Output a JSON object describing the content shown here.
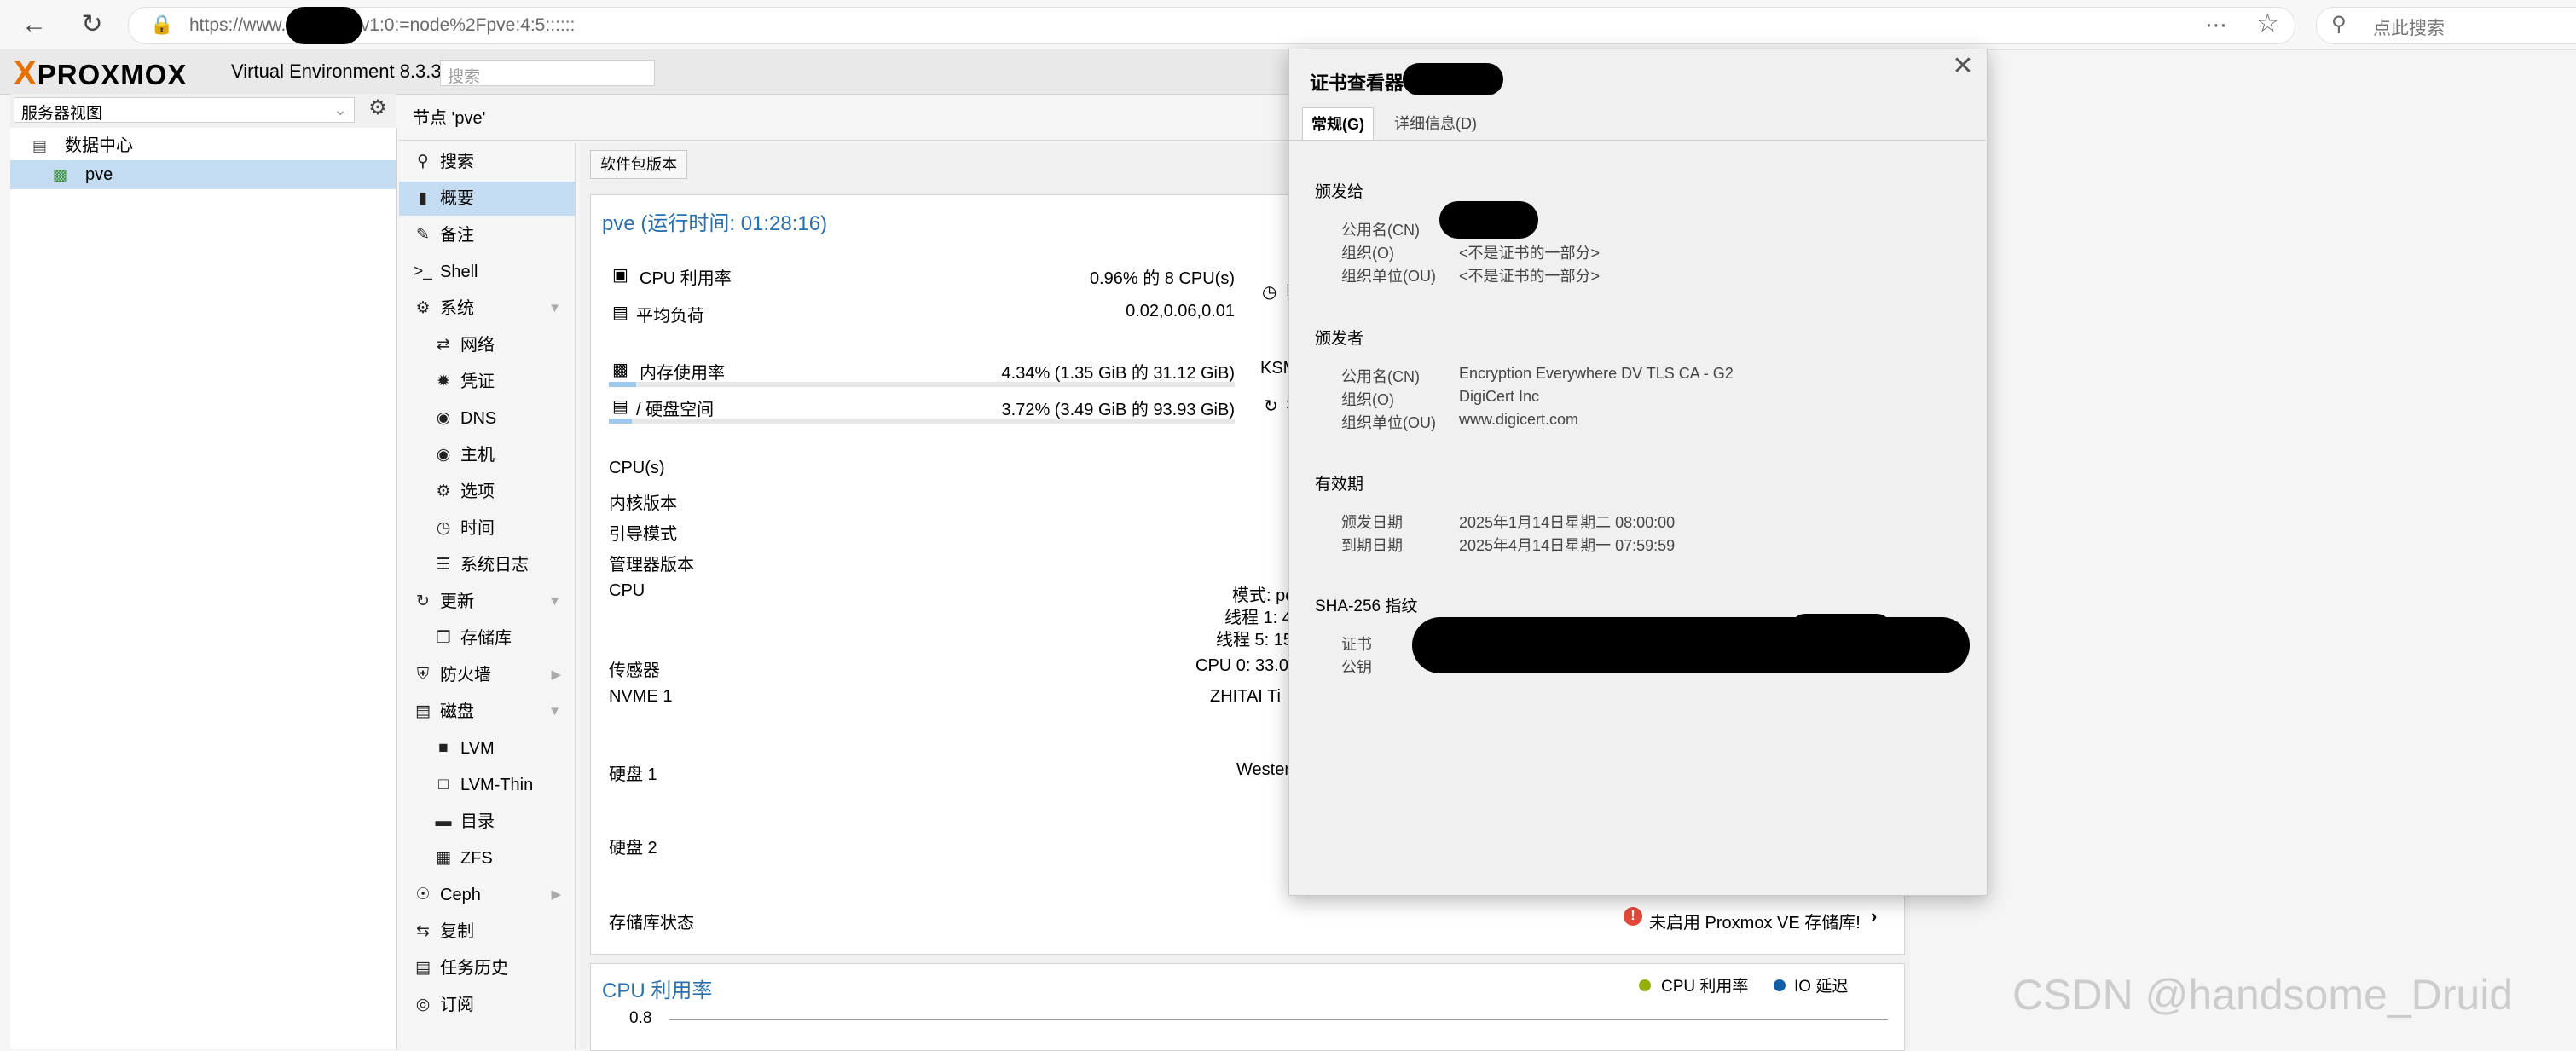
{
  "browser": {
    "url_text": "https://www.        n:8006/#v1:0:=node%2Fpve:4:5::::::",
    "search_placeholder": "点此搜索"
  },
  "header": {
    "logo_text": "PROXMOX",
    "version": "Virtual Environment 8.3.3",
    "search_placeholder": "搜索"
  },
  "tree": {
    "view_selector": "服务器视图",
    "items": [
      {
        "label": "数据中心"
      },
      {
        "label": "pve"
      }
    ]
  },
  "node_title": "节点 'pve'",
  "nav": {
    "items": [
      {
        "label": "搜索",
        "icon": "search-icon"
      },
      {
        "label": "概要",
        "icon": "book-icon"
      },
      {
        "label": "备注",
        "icon": "edit-icon"
      },
      {
        "label": "Shell",
        "icon": "terminal-icon"
      },
      {
        "label": "系统",
        "icon": "cogs-icon"
      },
      {
        "label": "网络",
        "icon": "network-icon"
      },
      {
        "label": "凭证",
        "icon": "certificate-icon"
      },
      {
        "label": "DNS",
        "icon": "globe-icon"
      },
      {
        "label": "主机",
        "icon": "globe-icon"
      },
      {
        "label": "选项",
        "icon": "gear-icon"
      },
      {
        "label": "时间",
        "icon": "clock-icon"
      },
      {
        "label": "系统日志",
        "icon": "list-icon"
      },
      {
        "label": "更新",
        "icon": "refresh-icon"
      },
      {
        "label": "存储库",
        "icon": "files-icon"
      },
      {
        "label": "防火墙",
        "icon": "shield-icon"
      },
      {
        "label": "磁盘",
        "icon": "hdd-icon"
      },
      {
        "label": "LVM",
        "icon": "square-icon"
      },
      {
        "label": "LVM-Thin",
        "icon": "square-outline-icon"
      },
      {
        "label": "目录",
        "icon": "folder-icon"
      },
      {
        "label": "ZFS",
        "icon": "grid-icon"
      },
      {
        "label": "Ceph",
        "icon": "ceph-icon"
      },
      {
        "label": "复制",
        "icon": "retweet-icon"
      },
      {
        "label": "任务历史",
        "icon": "list-alt-icon"
      },
      {
        "label": "订阅",
        "icon": "support-icon"
      }
    ]
  },
  "summary": {
    "package_button": "软件包版本",
    "title": "pve (运行时间: 01:28:16)",
    "cpu_label": "CPU 利用率",
    "cpu_value": "0.96% 的 8 CPU(s)",
    "load_label": "平均负荷",
    "load_value": "0.02,0.06,0.01",
    "mem_label": "内存使用率",
    "mem_value": "4.34% (1.35 GiB 的 31.12 GiB)",
    "mem_fraction": 0.0434,
    "disk_label": "/ 硬盘空间",
    "disk_value": "3.72% (3.49 GiB 的 93.93 GiB)",
    "disk_fraction": 0.0372,
    "ksm_label": "KSM",
    "right_partial_1": "I",
    "right_partial_2": "S",
    "rows": [
      {
        "label": "CPU(s)",
        "value": ""
      },
      {
        "label": "内核版本",
        "value": ""
      },
      {
        "label": "引导模式",
        "value": ""
      },
      {
        "label": "管理器版本",
        "value": ""
      },
      {
        "label": "CPU",
        "value": "模式: pe"
      },
      {
        "label": "",
        "value": "线程 1: 4"
      },
      {
        "label": "",
        "value": "线程 5: 15"
      },
      {
        "label": "传感器",
        "value": "CPU 0: 33.0"
      },
      {
        "label": "NVME 1",
        "value": "ZHITAI Ti"
      },
      {
        "label": "硬盘 1",
        "value": "Wester"
      },
      {
        "label": "硬盘 2",
        "value": ""
      },
      {
        "label": "存储库状态",
        "value": "未启用 Proxmox VE 存储库!"
      }
    ],
    "chart_title": "CPU 利用率",
    "chart_legend": [
      "CPU 利用率",
      "IO 延迟"
    ],
    "chart_tick": "0.8"
  },
  "dialog": {
    "title": "证书查看器",
    "tabs": [
      "常规(G)",
      "详细信息(D)"
    ],
    "issued_to": {
      "heading": "颁发给",
      "cn_key": "公用名(CN)",
      "cn_value": "",
      "o_key": "组织(O)",
      "o_value": "<不是证书的一部分>",
      "ou_key": "组织单位(OU)",
      "ou_value": "<不是证书的一部分>"
    },
    "issued_by": {
      "heading": "颁发者",
      "cn_key": "公用名(CN)",
      "cn_value": "Encryption Everywhere DV TLS CA - G2",
      "o_key": "组织(O)",
      "o_value": "DigiCert Inc",
      "ou_key": "组织单位(OU)",
      "ou_value": "www.digicert.com"
    },
    "validity": {
      "heading": "有效期",
      "from_key": "颁发日期",
      "from_value": "2025年1月14日星期二 08:00:00",
      "to_key": "到期日期",
      "to_value": "2025年4月14日星期一 07:59:59"
    },
    "fingerprint": {
      "heading": "SHA-256 指纹",
      "cert_key": "证书",
      "key_key": "公钥"
    }
  },
  "watermark": "CSDN @handsome_Druid"
}
